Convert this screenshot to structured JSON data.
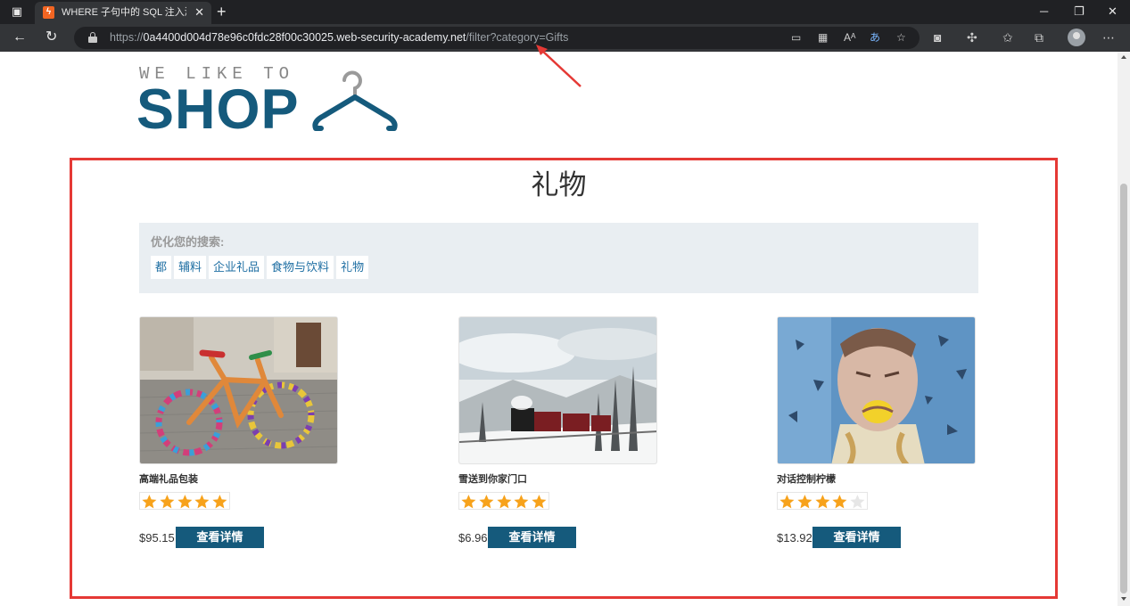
{
  "browser": {
    "tab_title": "WHERE 子句中的 SQL 注入漏洞允",
    "tab_favicon": "lightning-icon",
    "url_scheme": "https://",
    "url_host": "0a4400d004d78e96c0fdc28f00c30025.web-security-academy.net",
    "url_path": "/filter?category=Gifts",
    "accent_color": "#333538"
  },
  "page": {
    "logo_small": "WE LIKE TO",
    "logo_large": "SHOP",
    "logo_color": "#155a7c",
    "heading": "礼物",
    "filter": {
      "label": "优化您的搜索:",
      "links": [
        "都",
        "辅料",
        "企业礼品",
        "食物与饮料",
        "礼物"
      ]
    },
    "products": [
      {
        "name": "高端礼品包装",
        "rating": 5,
        "price": "$95.15",
        "button": "查看详情",
        "image": "yarn-bombed-bicycle"
      },
      {
        "name": "雪送到你家门口",
        "rating": 5,
        "price": "$6.96",
        "button": "查看详情",
        "image": "steam-train-in-snow"
      },
      {
        "name": "对话控制柠檬",
        "rating": 4,
        "price": "$13.92",
        "button": "查看详情",
        "image": "man-biting-lemon"
      }
    ],
    "highlight_color": "#e53935"
  }
}
